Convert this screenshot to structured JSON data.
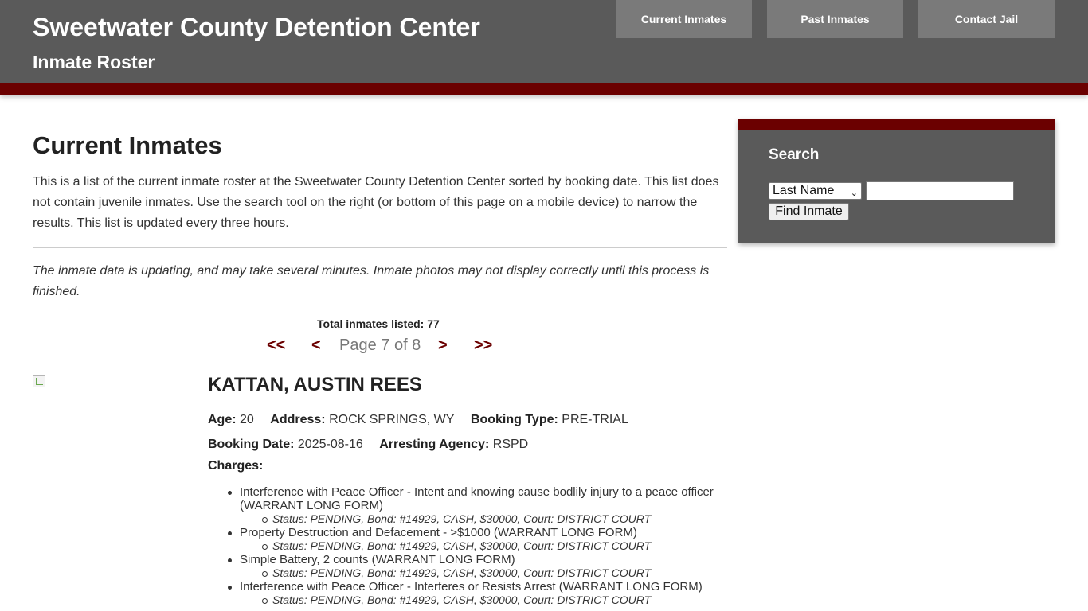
{
  "header": {
    "title": "Sweetwater County Detention Center",
    "subtitle": "Inmate Roster",
    "nav": [
      {
        "label": "Current Inmates"
      },
      {
        "label": "Past Inmates"
      },
      {
        "label": "Contact Jail"
      }
    ]
  },
  "main": {
    "heading": "Current Inmates",
    "intro": "This is a list of the current inmate roster at the Sweetwater County Detention Center sorted by booking date. This list does not contain juvenile inmates. Use the search tool on the right (or bottom of this page on a mobile device) to narrow the results. This list is updated every three hours.",
    "notice": "The inmate data is updating, and may take several minutes. Inmate photos may not display correctly until this process is finished.",
    "total_text": "Total inmates listed: 77",
    "pager": {
      "first": "<<",
      "prev": "<",
      "label": "Page 7 of 8",
      "next": ">",
      "last": ">>"
    },
    "inmate": {
      "name": "KATTAN, AUSTIN REES",
      "age_label": "Age:",
      "age": "20",
      "address_label": "Address:",
      "address": "ROCK SPRINGS, WY",
      "booking_type_label": "Booking Type:",
      "booking_type": "PRE-TRIAL",
      "booking_date_label": "Booking Date:",
      "booking_date": "2025-08-16",
      "agency_label": "Arresting Agency:",
      "agency": "RSPD",
      "charges_label": "Charges:",
      "charges": [
        {
          "text": "Interference with Peace Officer - Intent and knowing cause bodlily injury to a peace officer (WARRANT LONG FORM)",
          "status": "Status: PENDING, Bond: #14929, CASH, $30000, Court: DISTRICT COURT"
        },
        {
          "text": "Property Destruction and Defacement - >$1000 (WARRANT LONG FORM)",
          "status": "Status: PENDING, Bond: #14929, CASH, $30000, Court: DISTRICT COURT"
        },
        {
          "text": "Simple Battery, 2 counts (WARRANT LONG FORM)",
          "status": "Status: PENDING, Bond: #14929, CASH, $30000, Court: DISTRICT COURT"
        },
        {
          "text": "Interference with Peace Officer - Interferes or Resists Arrest (WARRANT LONG FORM)",
          "status": "Status: PENDING, Bond: #14929, CASH, $30000, Court: DISTRICT COURT"
        }
      ]
    }
  },
  "sidebar": {
    "search_title": "Search",
    "select_value": "Last Name",
    "input_value": "",
    "button_label": "Find Inmate"
  },
  "colors": {
    "header_bg": "#5a5a5a",
    "accent": "#6b0000",
    "nav_button": "#7a7a7a"
  }
}
